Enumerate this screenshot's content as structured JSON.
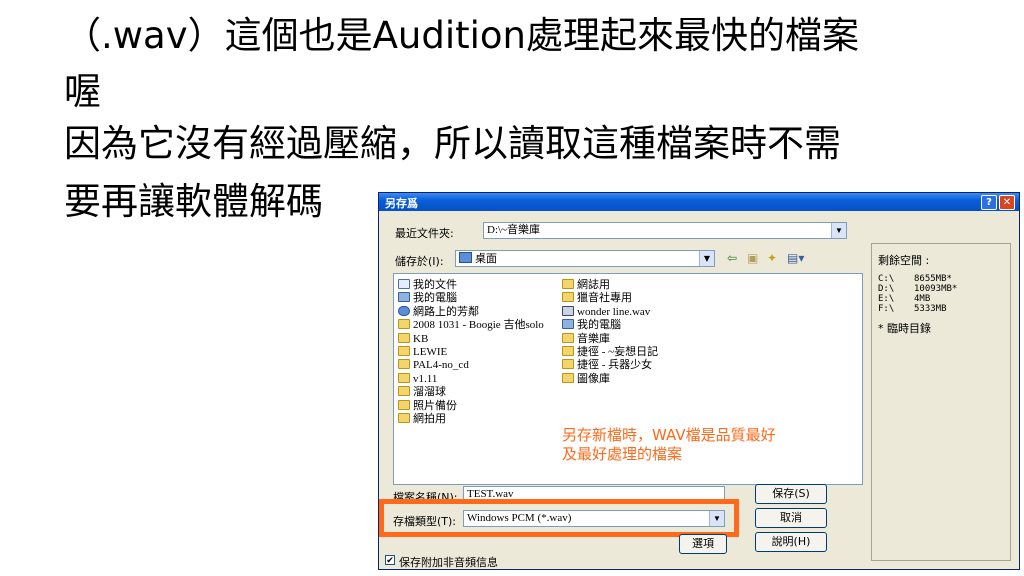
{
  "slide": {
    "line1": "（.wav）這個也是Audition處理起來最快的檔案",
    "line2": "喔",
    "line3": "因為它沒有經過壓縮，所以讀取這種檔案時不需",
    "line4": "要再讓軟體解碼"
  },
  "dialog": {
    "title": "另存爲",
    "help_btn": "?",
    "close_btn": "✕",
    "recent_label": "最近文件夾:",
    "recent_value": "D:\\~音樂庫",
    "save_in_label": "儲存於(I):",
    "save_in_value": "桌面",
    "files_left": [
      {
        "icon": "doc",
        "name": "我的文件"
      },
      {
        "icon": "pc",
        "name": "我的電腦"
      },
      {
        "icon": "net",
        "name": "網路上的芳鄰"
      },
      {
        "icon": "folder",
        "name": "2008 1031 - Boogie 吉他solo"
      },
      {
        "icon": "folder",
        "name": "KB"
      },
      {
        "icon": "folder",
        "name": "LEWIE"
      },
      {
        "icon": "folder",
        "name": "PAL4-no_cd"
      },
      {
        "icon": "folder",
        "name": "v1.11"
      },
      {
        "icon": "folder",
        "name": "溜溜球"
      },
      {
        "icon": "folder",
        "name": "照片備份"
      },
      {
        "icon": "folder",
        "name": "網拍用"
      }
    ],
    "files_right": [
      {
        "icon": "folder",
        "name": "網誌用"
      },
      {
        "icon": "folder",
        "name": "獵音社專用"
      },
      {
        "icon": "wav",
        "name": "wonder line.wav"
      },
      {
        "icon": "pc",
        "name": "我的電腦"
      },
      {
        "icon": "lnk",
        "name": "音樂庫"
      },
      {
        "icon": "lnk",
        "name": "捷徑 - ~妄想日記"
      },
      {
        "icon": "lnk",
        "name": "捷徑 - 兵器少女"
      },
      {
        "icon": "lnk",
        "name": "圖像庫"
      }
    ],
    "annotation_line1": "另存新檔時，WAV檔是品質最好",
    "annotation_line2": "及最好處理的檔案",
    "filename_label": "檔案名稱(N):",
    "filename_value": "TEST.wav",
    "filetype_label": "存檔類型(T):",
    "filetype_value": "Windows PCM (*.wav)",
    "save_btn": "保存(S)",
    "cancel_btn": "取消",
    "options_btn": "選項",
    "help_btn2": "說明(H)",
    "checkbox_checked": true,
    "checkbox_mark": "✔",
    "checkbox_label": "保存附加非音頻信息",
    "free_space_label": "剩餘空間 :",
    "drives": [
      {
        "drive": "C:\\",
        "space": "8655MB*"
      },
      {
        "drive": "D:\\",
        "space": "10093MB*"
      },
      {
        "drive": "E:\\",
        "space": "4MB"
      },
      {
        "drive": "F:\\",
        "space": "5333MB"
      }
    ],
    "temp_note": "* 臨時目錄"
  },
  "colors": {
    "annotation": "#ff6a1a",
    "titlebar": "#0a5fd8",
    "dialog_bg": "#ECE9D8"
  }
}
